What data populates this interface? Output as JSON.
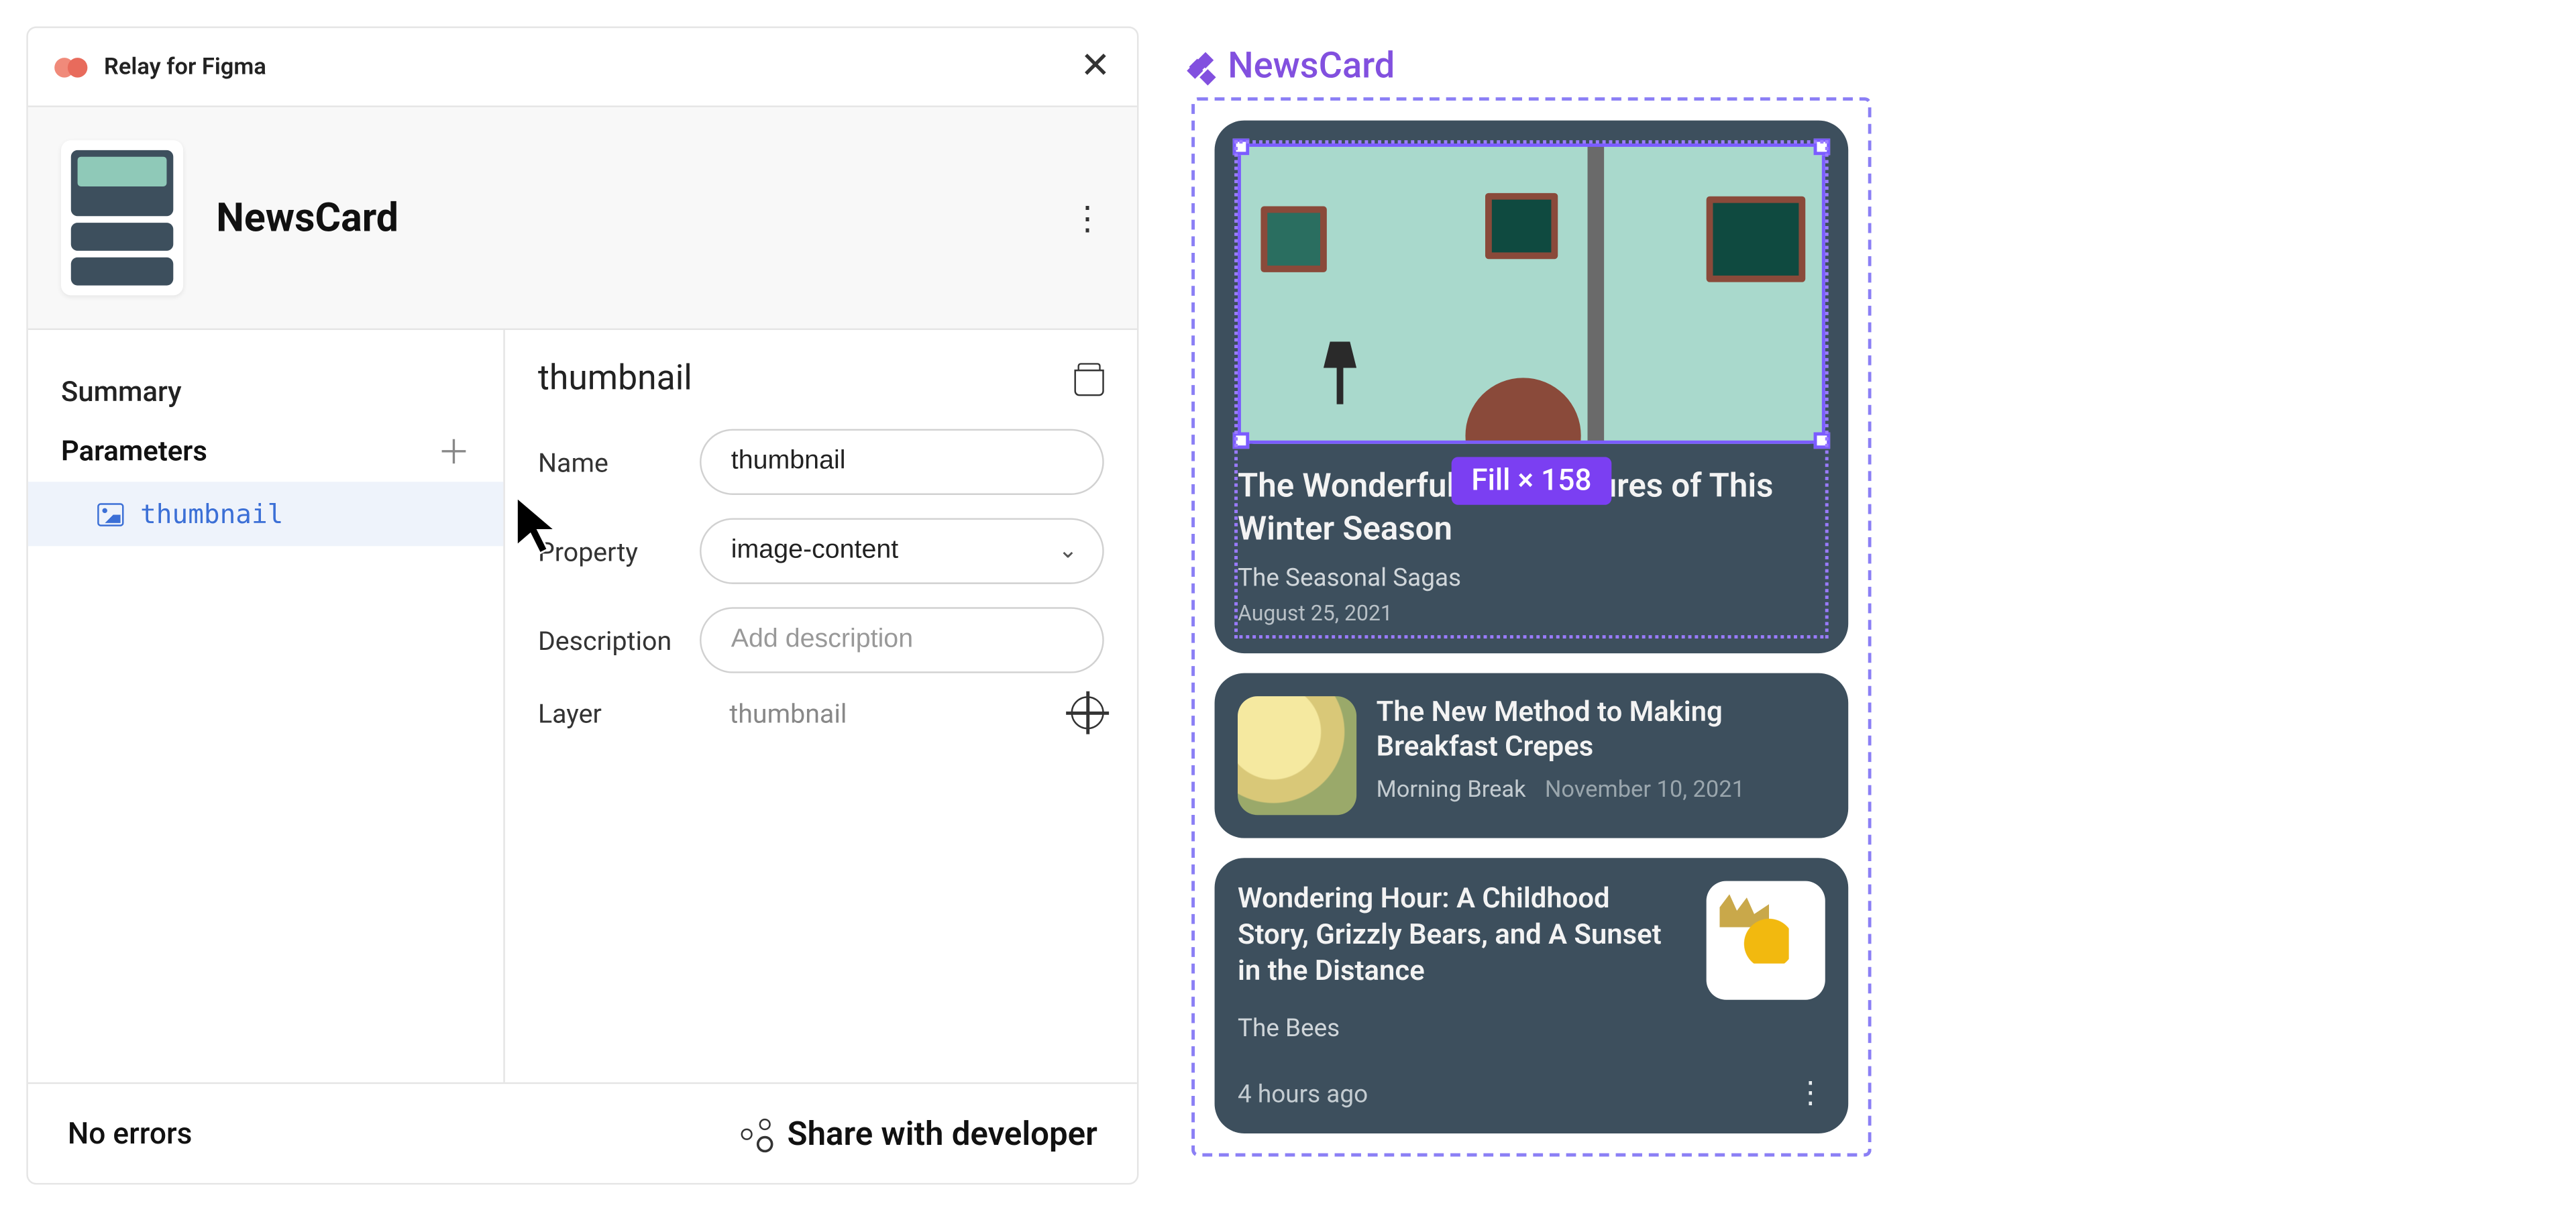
{
  "plugin": {
    "title": "Relay for Figma",
    "component_name": "NewsCard"
  },
  "sidebar": {
    "summary_label": "Summary",
    "parameters_label": "Parameters",
    "params": [
      {
        "name": "thumbnail"
      }
    ]
  },
  "detail": {
    "title": "thumbnail",
    "fields": {
      "name_label": "Name",
      "name_value": "thumbnail",
      "property_label": "Property",
      "property_value": "image-content",
      "description_label": "Description",
      "description_placeholder": "Add description",
      "layer_label": "Layer",
      "layer_value": "thumbnail"
    }
  },
  "footer": {
    "status": "No errors",
    "share_label": "Share with developer"
  },
  "canvas": {
    "component_label": "NewsCard",
    "size_badge": "Fill × 158",
    "cards": {
      "hero": {
        "title": "The Wonderful Architectures of This Winter Season",
        "subtitle": "The Seasonal Sagas",
        "date": "August 25, 2021"
      },
      "second": {
        "title": "The New Method to Making Breakfast Crepes",
        "source": "Morning Break",
        "date": "November 10, 2021"
      },
      "third": {
        "title": "Wondering Hour: A Childhood Story, Grizzly Bears, and A Sunset in the Distance",
        "subtitle": "The Bees",
        "ago": "4 hours ago"
      }
    }
  }
}
